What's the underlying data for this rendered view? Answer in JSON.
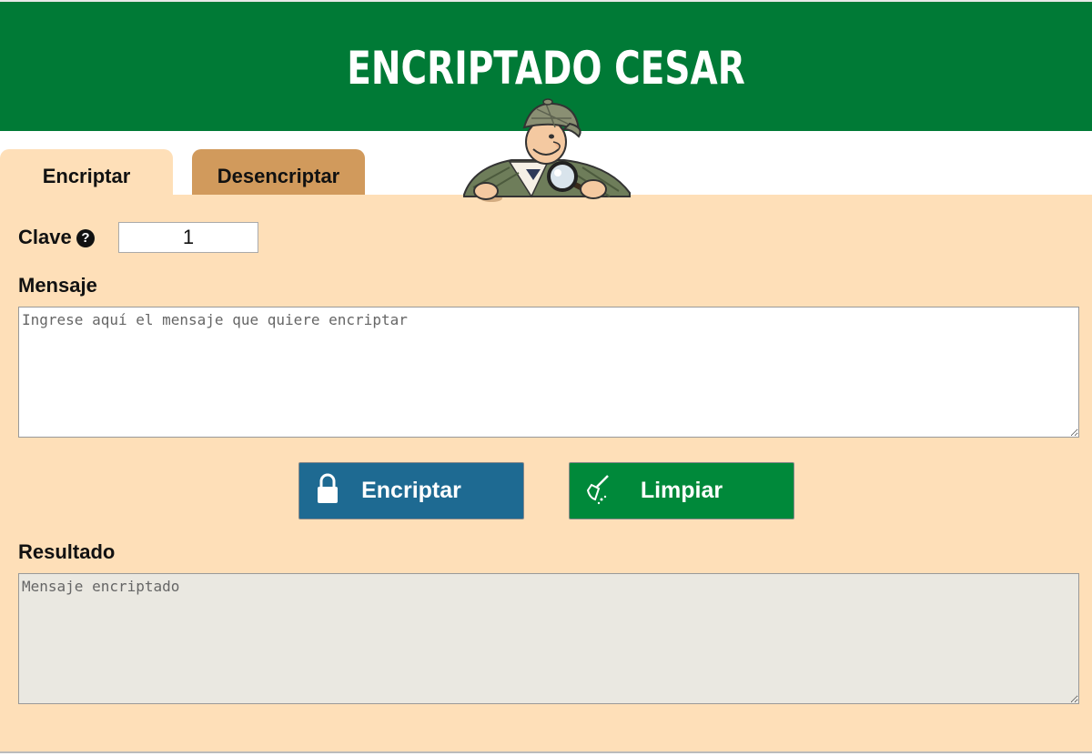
{
  "header": {
    "title": "ENCRIPTADO CESAR"
  },
  "tabs": [
    {
      "label": "Encriptar",
      "active": true
    },
    {
      "label": "Desencriptar",
      "active": false
    }
  ],
  "form": {
    "key_label": "Clave",
    "key_value": "1",
    "message_label": "Mensaje",
    "message_placeholder": "Ingrese aquí el mensaje que quiere encriptar",
    "result_label": "Resultado",
    "result_placeholder": "Mensaje encriptado"
  },
  "buttons": {
    "encrypt_label": "Encriptar",
    "clear_label": "Limpiar"
  },
  "icons": {
    "help": "question-circle-icon",
    "encrypt": "lock-icon",
    "clear": "broom-icon",
    "mascot": "detective-mascot"
  },
  "colors": {
    "header": "#007a36",
    "panel": "#fedfb8",
    "tab_inactive": "#d19a5c",
    "encrypt_button": "#1e6a92",
    "clear_button": "#00893a",
    "result_bg": "#eae8e1"
  }
}
